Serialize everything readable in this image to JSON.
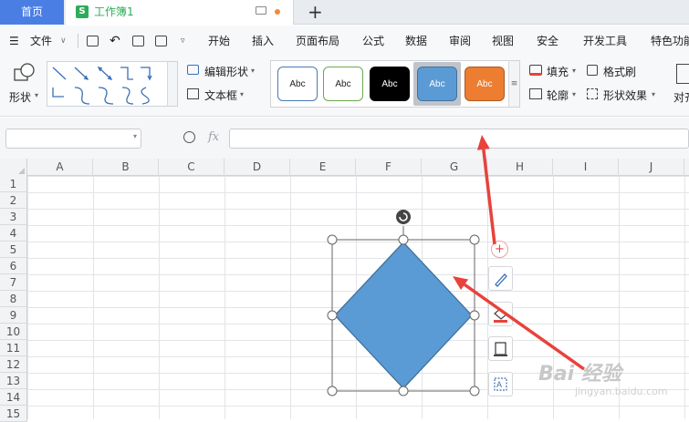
{
  "tabs": {
    "home": "首页",
    "workbook": "工作簿1",
    "workbook_icon": "S",
    "new_tab": "+"
  },
  "menu": {
    "file": "文件",
    "items": [
      "开始",
      "插入",
      "页面布局",
      "公式",
      "数据",
      "审阅",
      "视图",
      "安全",
      "开发工具",
      "特色功能"
    ]
  },
  "ribbon": {
    "shape_label": "形状",
    "edit_shape": "编辑形状",
    "text_box": "文本框",
    "style_presets": [
      {
        "label": "Abc",
        "bg": "#ffffff",
        "border": "#4a7ab8",
        "color": "#222222"
      },
      {
        "label": "Abc",
        "bg": "#ffffff",
        "border": "#6aa84f",
        "color": "#222222"
      },
      {
        "label": "Abc",
        "bg": "#000000",
        "border": "#000000",
        "color": "#ffffff"
      },
      {
        "label": "Abc",
        "bg": "#5b9bd5",
        "border": "#41719c",
        "color": "#ffffff"
      },
      {
        "label": "Abc",
        "bg": "#ed7d31",
        "border": "#ae5a21",
        "color": "#ffffff"
      }
    ],
    "fill": "填充",
    "outline": "轮廓",
    "format_painter": "格式刷",
    "shape_effects": "形状效果",
    "align": "对齐"
  },
  "formula_bar": {
    "name_box": "",
    "fx": "fx",
    "formula": ""
  },
  "grid": {
    "columns": [
      "A",
      "B",
      "C",
      "D",
      "E",
      "F",
      "G",
      "H",
      "I",
      "J"
    ],
    "rows": [
      "1",
      "2",
      "3",
      "4",
      "5",
      "6",
      "7",
      "8",
      "9",
      "10",
      "11",
      "12",
      "13",
      "14",
      "15"
    ]
  },
  "shape": {
    "type": "diamond",
    "fill_color": "#5b9bd5",
    "stroke_color": "#41719c"
  },
  "watermark": {
    "text": "Bai 经验",
    "sub": "jingyan.baidu.com"
  },
  "colors": {
    "accent": "#4a7ee3",
    "workbook_green": "#2eab5b",
    "arrow_red": "#e8423b"
  }
}
